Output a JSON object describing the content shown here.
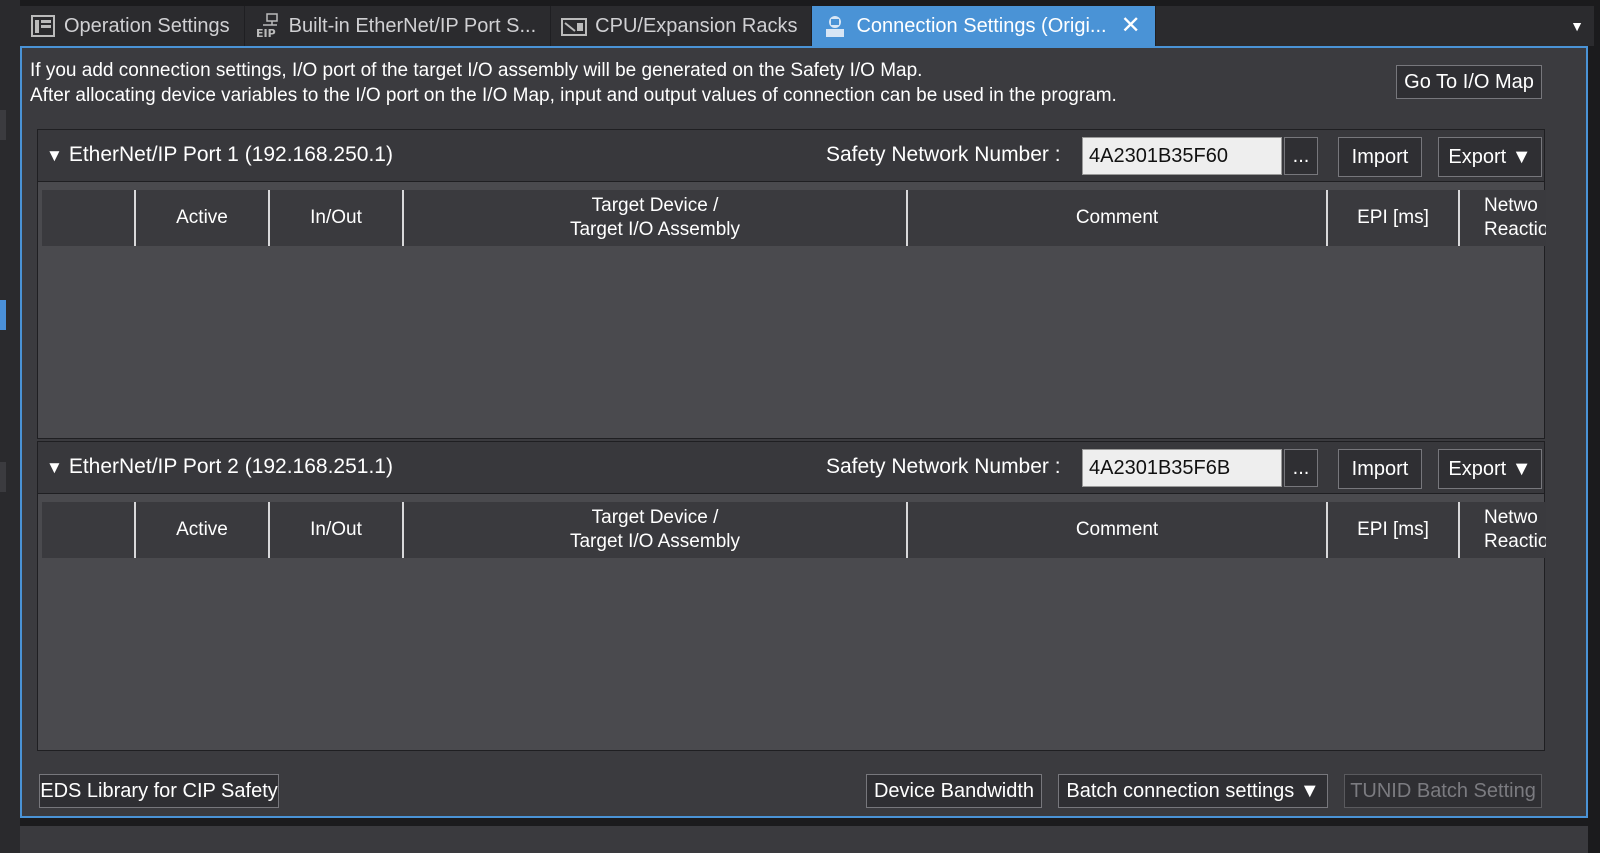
{
  "tabs": [
    {
      "label": "Operation Settings",
      "icon": "operation-settings-icon"
    },
    {
      "label": "Built-in EtherNet/IP Port S...",
      "icon": "eip-icon"
    },
    {
      "label": "CPU/Expansion Racks",
      "icon": "racks-icon"
    },
    {
      "label": "Connection Settings (Origi...",
      "icon": "connection-icon",
      "active": true,
      "close": "✕"
    }
  ],
  "tab_overflow": "▼",
  "info": {
    "line1": "If you add connection settings, I/O port of the target I/O assembly will be generated on the Safety I/O Map.",
    "line2": "After allocating device variables to the I/O port on the I/O Map, input and output values of connection can be used in the program."
  },
  "go_to_io_map": "Go To I/O Map",
  "ports": [
    {
      "title": "EtherNet/IP Port 1 (192.168.250.1)",
      "snn_label": "Safety Network Number :",
      "snn_value": "4A2301B35F60",
      "dots": "...",
      "import": "Import",
      "export": "Export ▼"
    },
    {
      "title": "EtherNet/IP Port 2 (192.168.251.1)",
      "snn_label": "Safety Network Number :",
      "snn_value": "4A2301B35F6B",
      "dots": "...",
      "import": "Import",
      "export": "Export ▼"
    }
  ],
  "columns": {
    "active": "Active",
    "inout": "In/Out",
    "target_line1": "Target Device /",
    "target_line2": "Target I/O Assembly",
    "comment": "Comment",
    "epi": "EPI [ms]",
    "network_line1": "Netwo",
    "network_line2": "Reactio"
  },
  "collapse_triangle": "▼",
  "footer": {
    "eds_library": "EDS Library for CIP Safety",
    "device_bandwidth": "Device Bandwidth",
    "batch_connection": "Batch connection settings ▼",
    "tunid_batch": "TUNID Batch Setting"
  },
  "colors": {
    "accent": "#4a93d6",
    "panel": "#3b3b3f",
    "header": "#38383c"
  }
}
